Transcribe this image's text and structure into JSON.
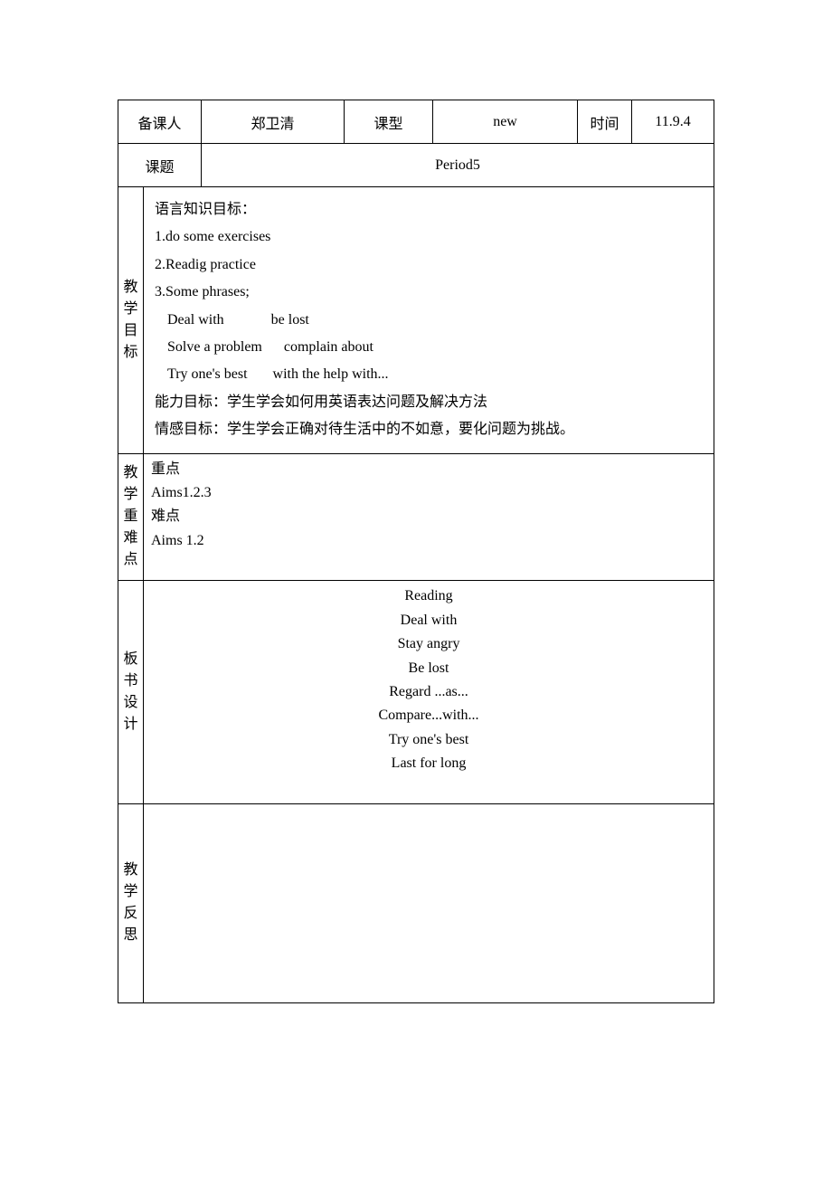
{
  "header": {
    "preparer_label": "备课人",
    "preparer_value": "郑卫清",
    "type_label": "课型",
    "type_value": "new",
    "time_label": "时间",
    "time_value": "11.9.4",
    "topic_label": "课题",
    "topic_value": "Period5"
  },
  "objectives": {
    "label": "教学目标",
    "knowledge_header": "语言知识目标：",
    "item1": "1.do some exercises",
    "item2": "2.Readig practice",
    "item3": "3.Some phrases;",
    "phrase1a": "Deal with",
    "phrase1b": "be lost",
    "phrase2a": "Solve a problem",
    "phrase2b": "complain about",
    "phrase3a": "Try one's best",
    "phrase3b": "with the help with...",
    "ability": "能力目标：学生学会如何用英语表达问题及解决方法",
    "emotion": "情感目标：学生学会正确对待生活中的不如意，要化问题为挑战。"
  },
  "focus": {
    "label": "教学重难点",
    "line1": "重点",
    "line2": "Aims1.2.3",
    "line3": "难点",
    "line4": "Aims 1.2"
  },
  "board": {
    "label": "板书设计",
    "line1": "Reading",
    "line2": "Deal with",
    "line3": "Stay angry",
    "line4": "Be lost",
    "line5": "Regard ...as...",
    "line6": "Compare...with...",
    "line7": "Try one's best",
    "line8": "Last for long"
  },
  "reflection": {
    "label": "教学反思"
  }
}
